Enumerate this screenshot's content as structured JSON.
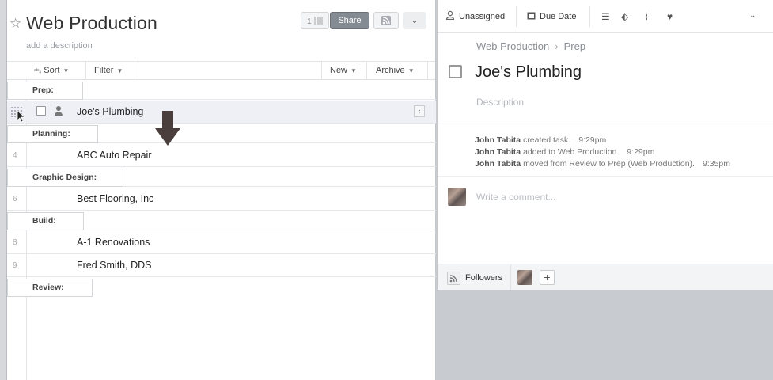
{
  "project": {
    "title": "Web Production",
    "description_placeholder": "add a description",
    "member_count": "1",
    "share_label": "Share"
  },
  "toolbar": {
    "sort_label": "Sort",
    "sort_icon": "ab-sort-icon",
    "filter_label": "Filter",
    "new_label": "New",
    "archive_label": "Archive"
  },
  "sections": [
    {
      "label": "Prep:",
      "tasks": [
        {
          "name": "Joe's Plumbing",
          "num": "",
          "selected": true
        }
      ]
    },
    {
      "label": "Planning:",
      "tasks": [
        {
          "name": "ABC Auto Repair",
          "num": "4"
        }
      ]
    },
    {
      "label": "Graphic Design:",
      "tasks": [
        {
          "name": "Best Flooring, Inc",
          "num": "6"
        }
      ]
    },
    {
      "label": "Build:",
      "tasks": [
        {
          "name": "A-1 Renovations",
          "num": "8"
        },
        {
          "name": "Fred Smith, DDS",
          "num": "9"
        }
      ]
    },
    {
      "label": "Review:",
      "tasks": []
    }
  ],
  "detail": {
    "assignee_label": "Unassigned",
    "due_label": "Due Date",
    "breadcrumb": [
      "Web Production",
      "Prep"
    ],
    "task_title": "Joe's Plumbing",
    "description_placeholder": "Description",
    "activity": [
      {
        "user": "John Tabita",
        "action": "created task.",
        "time": "9:29pm"
      },
      {
        "user": "John Tabita",
        "action": "added to Web Production.",
        "time": "9:29pm"
      },
      {
        "user": "John Tabita",
        "action": "moved from Review to Prep (Web Production).",
        "time": "9:35pm"
      }
    ],
    "comment_placeholder": "Write a comment...",
    "followers_label": "Followers"
  },
  "colors": {
    "accent": "#858b93",
    "background": "#c9ccd1"
  }
}
